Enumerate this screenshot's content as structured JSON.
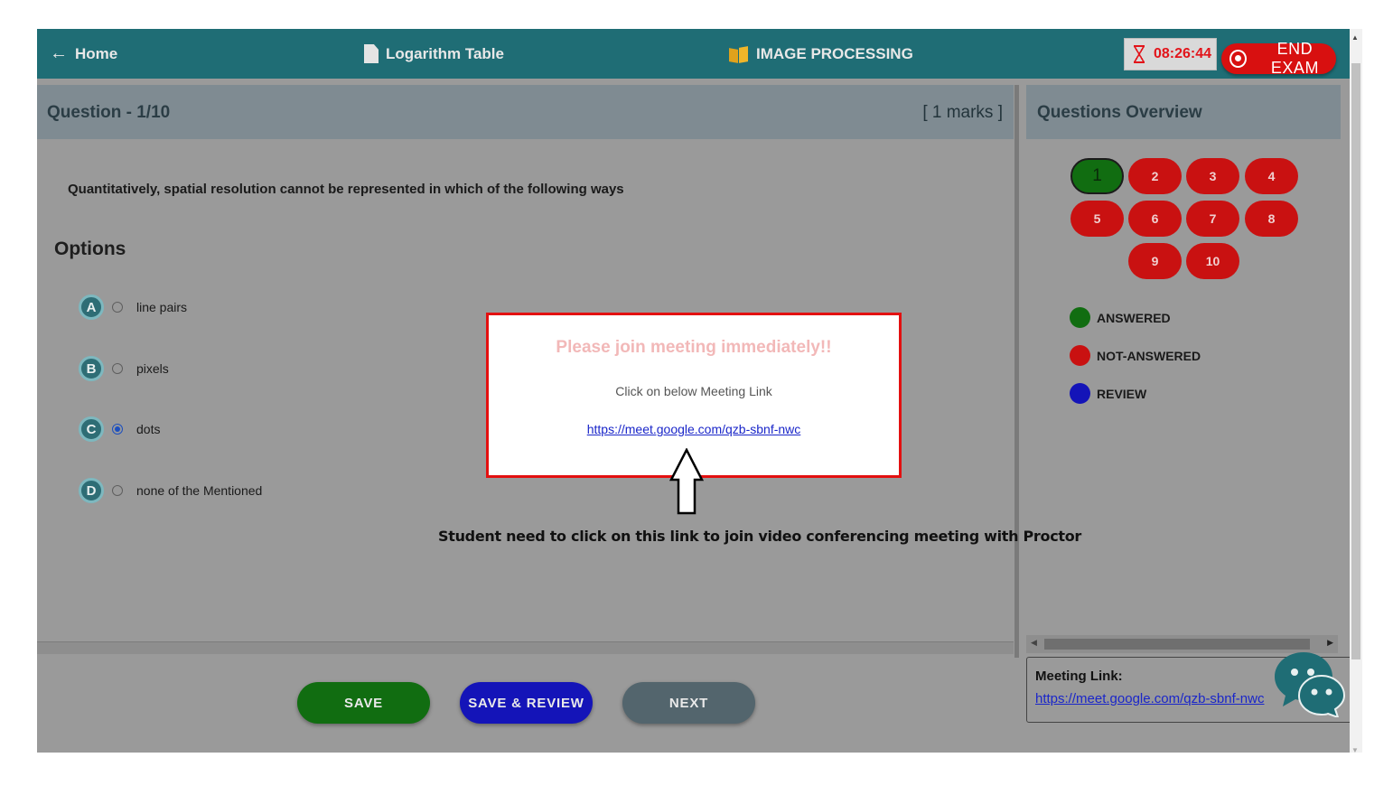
{
  "topbar": {
    "home_label": "Home",
    "log_table_label": "Logarithm Table",
    "subject_label": "IMAGE PROCESSING",
    "timer": "08:26:44",
    "end_exam_label": "END EXAM"
  },
  "question": {
    "number_label": "Question - 1/10",
    "marks_label": "[ 1 marks ]",
    "text": "Quantitatively, spatial resolution cannot be represented in which of the following ways",
    "options_title": "Options",
    "options": [
      {
        "letter": "A",
        "label": "line pairs",
        "selected": false
      },
      {
        "letter": "B",
        "label": "pixels",
        "selected": false
      },
      {
        "letter": "C",
        "label": "dots",
        "selected": true
      },
      {
        "letter": "D",
        "label": "none of the Mentioned",
        "selected": false
      }
    ]
  },
  "buttons": {
    "save": "SAVE",
    "save_review": "SAVE & REVIEW",
    "next": "NEXT"
  },
  "overview": {
    "title": "Questions Overview",
    "questions": [
      "1",
      "2",
      "3",
      "4",
      "5",
      "6",
      "7",
      "8",
      "9",
      "10"
    ],
    "current": "1",
    "legend": [
      {
        "label": "ANSWERED",
        "color": "#116d11"
      },
      {
        "label": "NOT-ANSWERED",
        "color": "#c91111"
      },
      {
        "label": "REVIEW",
        "color": "#1414b8"
      }
    ]
  },
  "meeting": {
    "label": "Meeting Link:",
    "link": "https://meet.google.com/qzb-sbnf-nwc"
  },
  "modal": {
    "title": "Please join meeting immediately!!",
    "subtitle": "Click on below Meeting Link",
    "link": "https://meet.google.com/qzb-sbnf-nwc"
  },
  "annotation": "Student need to click on this link to join video conferencing meeting with Proctor",
  "colors": {
    "topbar": "#1f6d75",
    "answered": "#116d11",
    "not_answered": "#c91111",
    "review": "#1414b8",
    "end_exam": "#d81010"
  }
}
